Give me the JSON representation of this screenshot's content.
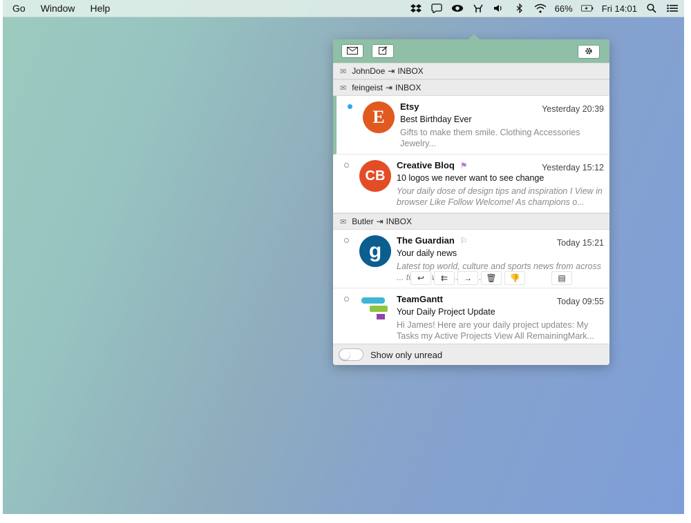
{
  "menubar": {
    "items": [
      "Go",
      "Window",
      "Help"
    ],
    "status_icons": [
      "dropbox-icon",
      "chat-icon",
      "eye-icon",
      "hands-icon",
      "volume-icon",
      "bluetooth-icon",
      "wifi-icon"
    ],
    "battery_percent": "66%",
    "clock": "Fri 14:01"
  },
  "popup": {
    "colors": {
      "toolbar": "#8fbfa7",
      "unread_dot": "#2ea6f0",
      "flag": "#b47ad6"
    },
    "accounts": [
      {
        "name": "JohnDoe",
        "mailbox": "INBOX"
      },
      {
        "name": "feingeist",
        "mailbox": "INBOX"
      },
      {
        "name": "Butler",
        "mailbox": "INBOX"
      }
    ],
    "messages": [
      {
        "sender": "Etsy",
        "time": "Yesterday 20:39",
        "subject": "Best Birthday Ever",
        "preview": "Gifts to make them smile. Clothing Accessories Jewelry...",
        "avatar": "E",
        "avatar_color": "#e05a1f"
      },
      {
        "sender": "Creative Bloq",
        "time": "Yesterday 15:12",
        "subject": "10 logos we never want to see change",
        "preview": "Your daily dose of design tips and inspiration I View in browser Like Follow Welcome! As champions o...",
        "avatar": "CB",
        "avatar_color": "#e34d26"
      },
      {
        "sender": "The Guardian",
        "time": "Today 15:21",
        "subject": "Your daily news",
        "preview": "Latest top world, culture and sports news from across ... to C... welco... to y...",
        "avatar": "g",
        "avatar_color": "#0b5e8e"
      },
      {
        "sender": "TeamGantt",
        "time": "Today 09:55",
        "subject": "Your Daily Project Update",
        "preview": "Hi James! Here are your daily project updates: My Tasks my Active Projects View All RemainingMark...",
        "avatar": "",
        "avatar_color": "#ffffff"
      }
    ],
    "footer_label": "Show only unread"
  }
}
